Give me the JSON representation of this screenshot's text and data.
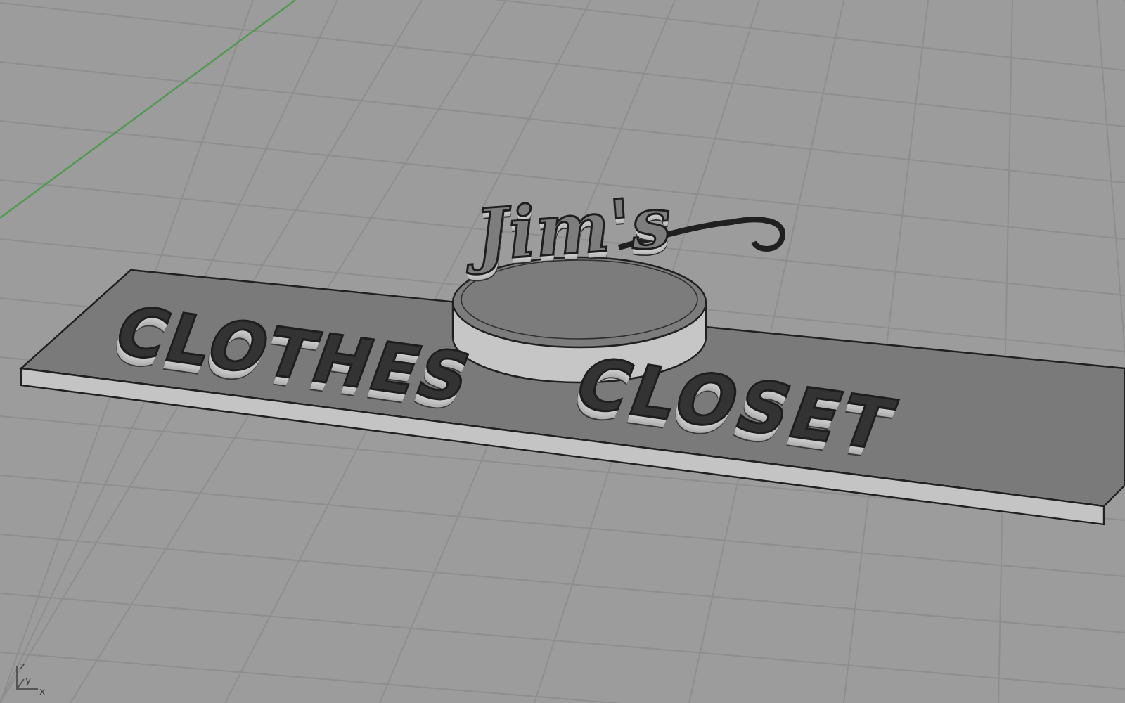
{
  "viewport": {
    "axis_labels": [
      "z",
      "y",
      "x"
    ]
  },
  "model": {
    "logo_text": "Jim's",
    "sign_words": [
      "CLOTHES",
      "CLOSET"
    ]
  }
}
